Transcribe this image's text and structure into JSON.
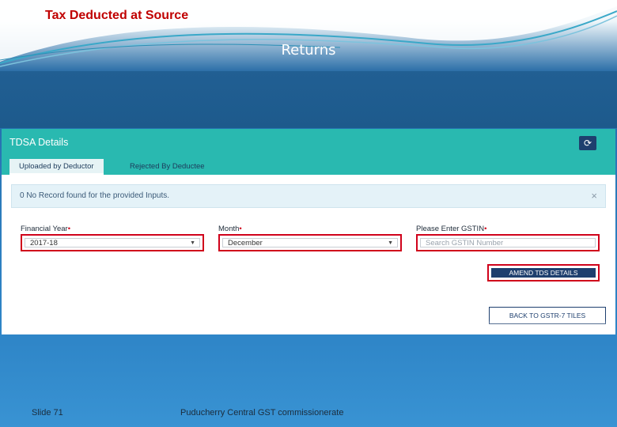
{
  "slide": {
    "top_title": "Tax Deducted at Source",
    "main_title": "Returns",
    "footer_slide": "Slide 71",
    "footer_org": "Puducherry Central GST commissionerate"
  },
  "panel": {
    "title": "TDSA Details",
    "refresh_icon": "refresh-icon",
    "refresh_glyph": "⟳",
    "tabs": [
      {
        "label": "Uploaded by Deductor",
        "active": true
      },
      {
        "label": "Rejected By Deductee",
        "active": false
      }
    ],
    "alert_text": "0 No Record found for the provided Inputs.",
    "alert_close": "×",
    "fields": {
      "financial_year": {
        "label": "Financial Year",
        "value": "2017-18"
      },
      "month": {
        "label": "Month",
        "value": "December"
      },
      "gstin": {
        "label": "Please Enter GSTIN",
        "placeholder": "Search GSTIN Number"
      }
    },
    "required_mark": "•",
    "caret": "▼",
    "amend_button": "AMEND TDS DETAILS",
    "back_button": "BACK TO GSTR-7 TILES"
  },
  "colors": {
    "header": "#29b9b0",
    "highlight": "#d0021b",
    "button": "#1e3f6e"
  }
}
